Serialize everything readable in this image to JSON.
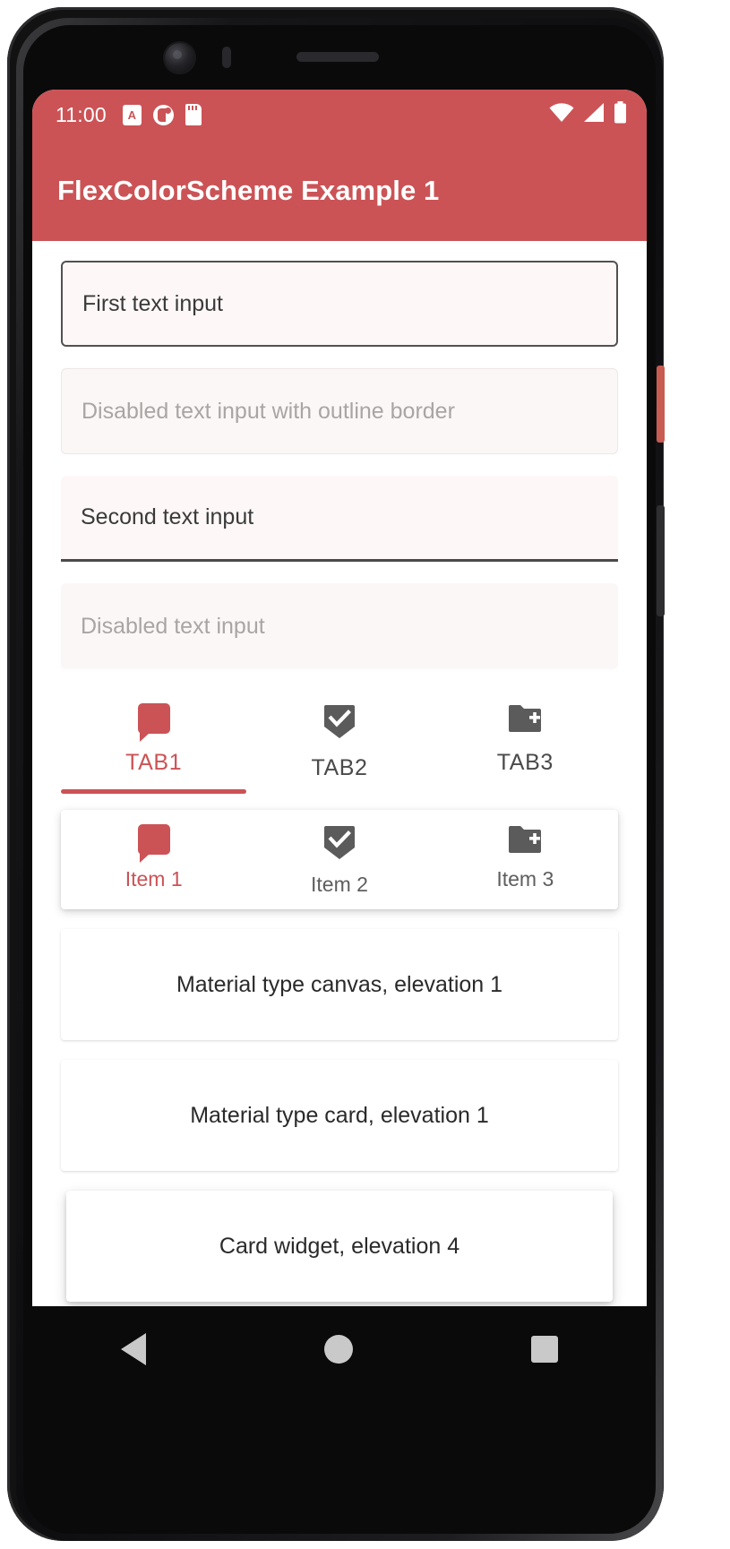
{
  "status_bar": {
    "time": "11:00",
    "left_icons": [
      {
        "name": "alarm-badge-icon",
        "glyph": "A"
      },
      {
        "name": "do-not-disturb-icon",
        "glyph": ""
      },
      {
        "name": "sd-card-icon",
        "glyph": ""
      }
    ],
    "right_icons": [
      {
        "name": "wifi-icon"
      },
      {
        "name": "cellular-signal-icon"
      },
      {
        "name": "battery-icon"
      }
    ],
    "background_color": "#CB5356"
  },
  "app_bar": {
    "title": "FlexColorScheme Example 1",
    "background_color": "#CB5356",
    "title_color": "#FFFFFF"
  },
  "text_fields": [
    {
      "value": "First text input",
      "disabled": false,
      "style": "outlined"
    },
    {
      "value": "Disabled text input with outline border",
      "disabled": true,
      "style": "outlined"
    },
    {
      "value": "Second text input",
      "disabled": false,
      "style": "filled"
    },
    {
      "value": "Disabled text input",
      "disabled": true,
      "style": "filled"
    }
  ],
  "tabs": [
    {
      "label": "TAB1",
      "icon": "chat-bubble-icon",
      "active": true
    },
    {
      "label": "TAB2",
      "icon": "beenhere-check-icon",
      "active": false
    },
    {
      "label": "TAB3",
      "icon": "create-new-folder-icon",
      "active": false
    }
  ],
  "bottom_nav": [
    {
      "label": "Item 1",
      "icon": "chat-bubble-icon",
      "active": true
    },
    {
      "label": "Item 2",
      "icon": "beenhere-check-icon",
      "active": false
    },
    {
      "label": "Item 3",
      "icon": "create-new-folder-icon",
      "active": false
    }
  ],
  "surfaces": [
    {
      "label": "Material type canvas, elevation 1"
    },
    {
      "label": "Material type card, elevation 1"
    },
    {
      "label": "Card widget, elevation 4"
    }
  ],
  "android_nav": {
    "back": "back-button",
    "home": "home-button",
    "recents": "recents-button"
  },
  "colors": {
    "primary": "#CB5356",
    "on_primary": "#FFFFFF",
    "field_fill": "#FDF8F7",
    "disabled_text": "#A9A5A4"
  }
}
